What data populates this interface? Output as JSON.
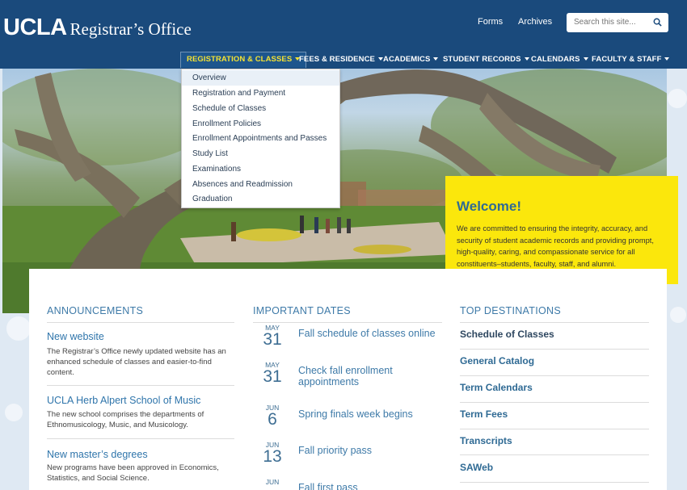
{
  "header": {
    "logo_ucla": "UCLA",
    "logo_office": "Registrar’s Office",
    "links": [
      "Forms",
      "Archives"
    ],
    "search_placeholder": "Search this site...",
    "search_icon": "search-icon"
  },
  "nav": {
    "items": [
      {
        "label": "REGISTRATION & CLASSES"
      },
      {
        "label": "FEES & RESIDENCE"
      },
      {
        "label": "ACADEMICS"
      },
      {
        "label": "STUDENT RECORDS"
      },
      {
        "label": "CALENDARS"
      },
      {
        "label": "FACULTY & STAFF"
      }
    ]
  },
  "dropdown": {
    "items": [
      "Overview",
      "Registration and Payment",
      "Schedule of Classes",
      "Enrollment Policies",
      "Enrollment Appointments and Passes",
      "Study List",
      "Examinations",
      "Absences and Readmission",
      "Graduation"
    ]
  },
  "welcome": {
    "title": "Welcome!",
    "text": "We are committed to ensuring the integrity, accuracy, and security of student academic records and providing prompt, high-quality, caring, and compassionate service for all constituents–students, faculty, staff, and alumni."
  },
  "announcements": {
    "heading": "ANNOUNCEMENTS",
    "items": [
      {
        "title": "New website",
        "text": "The Registrar’s Office newly updated website has an enhanced schedule of classes and easier-to-find content."
      },
      {
        "title": "UCLA Herb Alpert School of Music",
        "text": "The new school comprises the departments of Ethnomusicology, Music, and Musicology."
      },
      {
        "title": "New master’s degrees",
        "text": "New programs have been approved in Economics, Statistics, and Social Science."
      }
    ]
  },
  "dates": {
    "heading": "IMPORTANT DATES",
    "items": [
      {
        "month": "MAY",
        "day": "31",
        "title": "Fall schedule of classes online"
      },
      {
        "month": "MAY",
        "day": "31",
        "title": "Check fall enrollment appointments"
      },
      {
        "month": "JUN",
        "day": "6",
        "title": "Spring finals week begins"
      },
      {
        "month": "JUN",
        "day": "13",
        "title": "Fall priority pass"
      },
      {
        "month": "JUN",
        "day": "",
        "title": "Fall first pass"
      }
    ]
  },
  "destinations": {
    "heading": "TOP DESTINATIONS",
    "items": [
      "Schedule of Classes",
      "General Catalog",
      "Term Calendars",
      "Term Fees",
      "Transcripts",
      "SAWeb"
    ]
  },
  "colors": {
    "header_bg": "#1a4a7c",
    "active_nav": "#f5e232",
    "welcome_bg": "#fbe70c",
    "link_blue": "#2f75ab"
  }
}
